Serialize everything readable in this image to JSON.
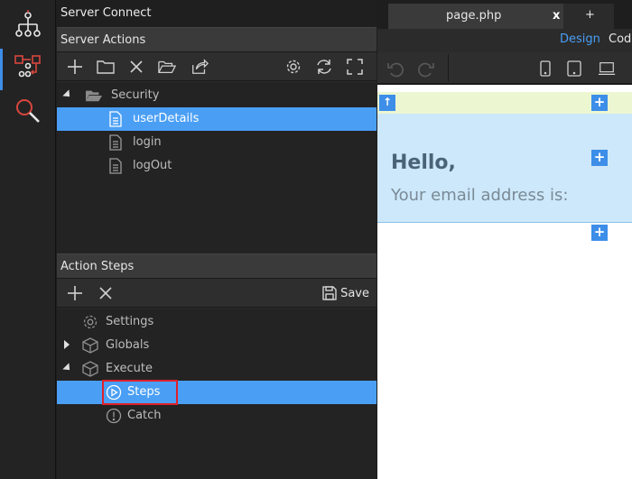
{
  "app": {
    "title": "Server Connect"
  },
  "colors": {
    "accent": "#4a9ff5",
    "highlight": "#e0202a"
  },
  "rail": {
    "items": [
      {
        "icon": "sitemap-icon"
      },
      {
        "icon": "server-connect-icon",
        "active": true
      },
      {
        "icon": "search-icon"
      }
    ]
  },
  "server_actions": {
    "title": "Server Actions",
    "toolbar": [
      "add-icon",
      "new-folder-icon",
      "delete-icon",
      "open-folder-icon",
      "export-icon",
      "settings-icon",
      "refresh-icon",
      "fullscreen-icon"
    ],
    "tree": [
      {
        "label": "Security",
        "type": "folder",
        "expanded": true
      },
      {
        "label": "userDetails",
        "type": "file",
        "selected": true
      },
      {
        "label": "login",
        "type": "file"
      },
      {
        "label": "logOut",
        "type": "file"
      }
    ]
  },
  "action_steps": {
    "title": "Action Steps",
    "save_label": "Save",
    "tree": [
      {
        "label": "Settings",
        "icon": "gear-icon"
      },
      {
        "label": "Globals",
        "icon": "cube-icon",
        "collapsed": true
      },
      {
        "label": "Execute",
        "icon": "cube-icon",
        "expanded": true
      },
      {
        "label": "Steps",
        "icon": "play-circle-icon",
        "selected": true
      },
      {
        "label": "Catch",
        "icon": "alert-circle-icon"
      }
    ]
  },
  "editor": {
    "tabs": [
      {
        "label": "page.php",
        "close": "x"
      },
      {
        "label": "+"
      }
    ],
    "modes": {
      "design": "Design",
      "code": "Code"
    },
    "content": {
      "heading": "Hello,",
      "text": "Your email address is:"
    }
  }
}
